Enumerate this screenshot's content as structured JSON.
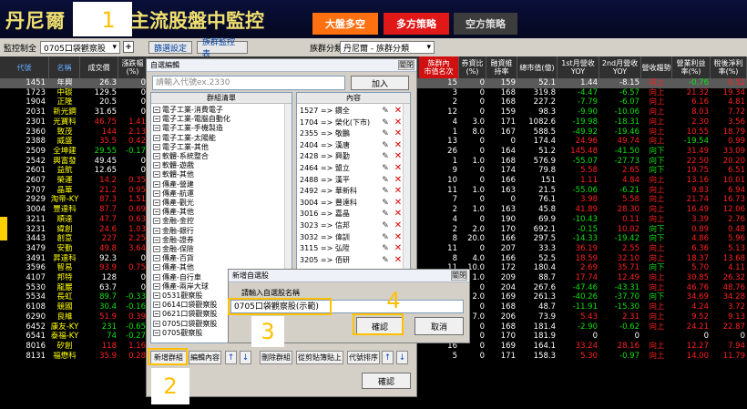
{
  "header": {
    "title_left": "丹尼爾",
    "title_right": "主流股盤中監控",
    "buttons": [
      "大盤多空",
      "多方策略",
      "空方策略"
    ]
  },
  "toolbar": {
    "monitor_label": "監控制全",
    "list_value": "0705口袋觀察股",
    "plus": "+",
    "filter_btn": "篩選設定",
    "group_btn": "族群監控表",
    "sector_label": "族群分類",
    "sector_value": "丹尼爾 - 族群分類"
  },
  "table": {
    "headers": [
      "代號",
      "名稱",
      "成交價",
      "漲跌幅\n(%)",
      "",
      "",
      "",
      "族群內\n市值名次",
      "券資比\n(%)",
      "融資維\n持率",
      "總市值(億)",
      "1st月營收\nYOY",
      "2nd月營收\nYOY",
      "營收趨勢",
      "營業利益\n率(%)",
      "稅後淨利\n率(%)"
    ],
    "rows": [
      {
        "code": "1451",
        "name": "年興",
        "price": "26.3",
        "chg": "0",
        "rank": "15",
        "qz": "0",
        "rz": "159",
        "cap": "52.1",
        "y1": "1.44",
        "y2": "-8.15",
        "tr": "向上",
        "op": "-0.76",
        "np": "0.52",
        "c": [
          "w",
          "w",
          "w",
          "w"
        ],
        "sel": true
      },
      {
        "code": "1723",
        "name": "中碳",
        "price": "129.5",
        "chg": "0",
        "rank": "3",
        "qz": "0",
        "rz": "168",
        "cap": "319.8",
        "y1": "-4.47",
        "y2": "-6.57",
        "tr": "向上",
        "op": "21.32",
        "np": "19.34",
        "c": [
          "w",
          "w",
          "g",
          "g"
        ]
      },
      {
        "code": "1904",
        "name": "正隆",
        "price": "20.5",
        "chg": "0",
        "rank": "2",
        "qz": "0",
        "rz": "168",
        "cap": "227.2",
        "y1": "-7.79",
        "y2": "-6.07",
        "tr": "向上",
        "op": "6.16",
        "np": "4.81",
        "c": [
          "w",
          "w",
          "g",
          "g"
        ]
      },
      {
        "code": "2031",
        "name": "新光鋼",
        "price": "31.65",
        "chg": "0",
        "rank": "12",
        "qz": "0",
        "rz": "159",
        "cap": "98.3",
        "y1": "-9.90",
        "y2": "-10.06",
        "tr": "向上",
        "op": "8.03",
        "np": "7.72",
        "c": [
          "w",
          "w",
          "g",
          "g"
        ]
      },
      {
        "code": "2301",
        "name": "光寶科",
        "price": "46.75",
        "chg": "1.41",
        "rank": "4",
        "qz": "3.0",
        "rz": "171",
        "cap": "1082.6",
        "y1": "-19.98",
        "y2": "-18.31",
        "tr": "向上",
        "op": "2.30",
        "np": "3.56",
        "c": [
          "r",
          "r",
          "g",
          "g"
        ]
      },
      {
        "code": "2360",
        "name": "致茂",
        "price": "144",
        "chg": "2.13",
        "rank": "1",
        "qz": "8.0",
        "rz": "167",
        "cap": "588.5",
        "y1": "-49.92",
        "y2": "-19.46",
        "tr": "向上",
        "op": "10.55",
        "np": "18.79",
        "c": [
          "r",
          "r",
          "g",
          "g"
        ]
      },
      {
        "code": "2388",
        "name": "威盛",
        "price": "35.5",
        "chg": "0.42",
        "rank": "13",
        "qz": "0",
        "rz": "0",
        "cap": "174.4",
        "y1": "24.96",
        "y2": "49.74",
        "tr": "向上",
        "op": "-19.54",
        "np": "0.99",
        "c": [
          "r",
          "r",
          "r",
          "r"
        ]
      },
      {
        "code": "2509",
        "name": "全坤建",
        "price": "29.55",
        "chg": "-0.17",
        "rank": "26",
        "qz": "0",
        "rz": "164",
        "cap": "51.2",
        "y1": "145.48",
        "y2": "-41.50",
        "tr": "向下",
        "op": "31.49",
        "np": "33.09",
        "c": [
          "g",
          "g",
          "r",
          "g"
        ]
      },
      {
        "code": "2542",
        "name": "興富發",
        "price": "49.45",
        "price_c": "w",
        "chg": "0",
        "rank": "1",
        "qz": "1.0",
        "rz": "168",
        "cap": "576.9",
        "y1": "-55.07",
        "y2": "-27.73",
        "tr": "向下",
        "op": "22.50",
        "np": "20.20",
        "c": [
          "w",
          "w",
          "g",
          "g"
        ]
      },
      {
        "code": "2601",
        "name": "益航",
        "price": "12.65",
        "chg": "0",
        "rank": "9",
        "qz": "0",
        "rz": "174",
        "cap": "79.8",
        "y1": "5.58",
        "y2": "2.65",
        "tr": "向下",
        "op": "19.75",
        "np": "6.51",
        "c": [
          "w",
          "w",
          "r",
          "r"
        ]
      },
      {
        "code": "2607",
        "name": "榮運",
        "price": "14.2",
        "chg": "0.35",
        "rank": "10",
        "qz": "0",
        "rz": "166",
        "cap": "151",
        "y1": "1.11",
        "y2": "4.84",
        "tr": "向上",
        "op": "13.16",
        "np": "10.01",
        "c": [
          "r",
          "r",
          "r",
          "r"
        ]
      },
      {
        "code": "2707",
        "name": "晶華",
        "price": "21.2",
        "chg": "0.95",
        "rank": "11",
        "qz": "1.0",
        "rz": "163",
        "cap": "21.5",
        "y1": "-55.06",
        "y2": "-6.21",
        "tr": "向上",
        "op": "9.83",
        "np": "6.94",
        "c": [
          "r",
          "r",
          "g",
          "g"
        ]
      },
      {
        "code": "2929",
        "name": "淘帝-KY",
        "price": "87.3",
        "chg": "1.51",
        "rank": "7",
        "qz": "0",
        "rz": "0",
        "cap": "76.1",
        "y1": "3.98",
        "y2": "5.58",
        "tr": "向上",
        "op": "21.74",
        "np": "16.73",
        "c": [
          "r",
          "r",
          "r",
          "r"
        ]
      },
      {
        "code": "3004",
        "name": "豐達科",
        "price": "87.7",
        "chg": "0.69",
        "rank": "2",
        "qz": "1.0",
        "rz": "163",
        "cap": "45.8",
        "y1": "41.89",
        "y2": "28.30",
        "tr": "向上",
        "op": "16.49",
        "np": "12.06",
        "c": [
          "r",
          "r",
          "r",
          "r"
        ]
      },
      {
        "code": "3211",
        "name": "順達",
        "price": "47.7",
        "chg": "0.63",
        "rank": "4",
        "qz": "0",
        "rz": "190",
        "cap": "69.9",
        "y1": "-10.43",
        "y2": "0.11",
        "tr": "向上",
        "op": "3.39",
        "np": "2.76",
        "c": [
          "r",
          "r",
          "g",
          "r"
        ]
      },
      {
        "code": "3231",
        "name": "緯創",
        "price": "24.6",
        "chg": "1.03",
        "rank": "2",
        "qz": "2.0",
        "rz": "170",
        "cap": "692.1",
        "y1": "-0.15",
        "y2": "10.02",
        "tr": "向下",
        "op": "0.89",
        "np": "0.48",
        "c": [
          "r",
          "r",
          "g",
          "r"
        ]
      },
      {
        "code": "3443",
        "name": "創意",
        "price": "227",
        "chg": "2.25",
        "rank": "8",
        "qz": "20.0",
        "rz": "166",
        "cap": "297.5",
        "y1": "-14.33",
        "y2": "-19.42",
        "tr": "向下",
        "op": "4.86",
        "np": "5.96",
        "c": [
          "r",
          "r",
          "g",
          "g"
        ]
      },
      {
        "code": "3479",
        "name": "安勤",
        "price": "49.8",
        "chg": "3.64",
        "rank": "11",
        "qz": "0",
        "rz": "207",
        "cap": "33.3",
        "y1": "36.19",
        "y2": "2.55",
        "tr": "向上",
        "op": "6.36",
        "np": "5.13",
        "c": [
          "r",
          "r",
          "r",
          "r"
        ]
      },
      {
        "code": "3491",
        "name": "昇達科",
        "price": "92.3",
        "chg": "0",
        "rank": "8",
        "qz": "4.0",
        "rz": "166",
        "cap": "52.5",
        "y1": "18.59",
        "y2": "32.10",
        "tr": "向上",
        "op": "18.37",
        "np": "13.68",
        "c": [
          "w",
          "w",
          "r",
          "r"
        ]
      },
      {
        "code": "3596",
        "name": "智易",
        "price": "93.9",
        "chg": "0.75",
        "rank": "11",
        "qz": "10.0",
        "rz": "172",
        "cap": "180.4",
        "y1": "2.69",
        "y2": "35.71",
        "tr": "向下",
        "op": "5.70",
        "np": "4.11",
        "c": [
          "r",
          "r",
          "r",
          "r"
        ]
      },
      {
        "code": "4107",
        "name": "邦特",
        "price": "128",
        "chg": "0",
        "rank": "1",
        "qz": "1.0",
        "rz": "209",
        "cap": "88.7",
        "y1": "17.74",
        "y2": "12.49",
        "tr": "向上",
        "op": "30.85",
        "np": "26.32",
        "c": [
          "w",
          "w",
          "r",
          "r"
        ]
      },
      {
        "code": "5530",
        "name": "龍巖",
        "price": "63.7",
        "chg": "0",
        "rank": "1",
        "qz": "0",
        "rz": "204",
        "cap": "267.6",
        "y1": "-47.46",
        "y2": "-43.31",
        "tr": "向上",
        "op": "46.76",
        "np": "48.76",
        "c": [
          "w",
          "w",
          "g",
          "g"
        ]
      },
      {
        "code": "5534",
        "name": "長虹",
        "price": "89.7",
        "chg": "-0.33",
        "rank": "3",
        "qz": "2.0",
        "rz": "169",
        "cap": "261.3",
        "y1": "-40.26",
        "y2": "-37.70",
        "tr": "向下",
        "op": "34.69",
        "np": "34.28",
        "c": [
          "g",
          "g",
          "g",
          "g"
        ]
      },
      {
        "code": "6108",
        "name": "競國",
        "price": "30.4",
        "chg": "-0.16",
        "rank": "8",
        "qz": "0",
        "rz": "168",
        "cap": "48.7",
        "y1": "-11.91",
        "y2": "-15.30",
        "tr": "向上",
        "op": "4.24",
        "np": "3.72",
        "c": [
          "g",
          "g",
          "g",
          "g"
        ]
      },
      {
        "code": "6290",
        "name": "良維",
        "price": "51.9",
        "chg": "0.39",
        "rank": "9",
        "qz": "7.0",
        "rz": "206",
        "cap": "73.9",
        "y1": "5.43",
        "y2": "2.31",
        "tr": "向上",
        "op": "9.52",
        "np": "9.13",
        "c": [
          "r",
          "r",
          "r",
          "r"
        ]
      },
      {
        "code": "6452",
        "name": "康友-KY",
        "price": "231",
        "chg": "-0.65",
        "rank": "9",
        "qz": "0",
        "rz": "168",
        "cap": "181.4",
        "y1": "-2.90",
        "y2": "-0.62",
        "tr": "向上",
        "op": "24.21",
        "np": "22.87",
        "c": [
          "g",
          "g",
          "g",
          "g"
        ]
      },
      {
        "code": "6541",
        "name": "泰福-KY",
        "price": "74",
        "chg": "-0.27",
        "rank": "6",
        "qz": "0",
        "rz": "170",
        "cap": "181.9",
        "y1": "0",
        "y2": "0",
        "tr": "",
        "op": "0",
        "np": "0",
        "c": [
          "g",
          "g",
          "w",
          "w"
        ]
      },
      {
        "code": "8016",
        "name": "矽創",
        "price": "118",
        "chg": "1.16",
        "rank": "16",
        "qz": "0",
        "rz": "169",
        "cap": "164.1",
        "y1": "33.24",
        "y2": "28.16",
        "tr": "向上",
        "op": "12.27",
        "np": "7.94",
        "c": [
          "r",
          "r",
          "r",
          "r"
        ]
      },
      {
        "code": "8131",
        "name": "福懋科",
        "price": "35.9",
        "chg": "0.28",
        "rank": "5",
        "qz": "0",
        "rz": "171",
        "cap": "158.3",
        "y1": "5.30",
        "y2": "-0.97",
        "tr": "向上",
        "op": "14.00",
        "np": "11.79",
        "c": [
          "r",
          "r",
          "r",
          "g"
        ]
      }
    ]
  },
  "dialog_watch": {
    "title": "自選編輯",
    "close": "關閉",
    "search_placeholder": "請輸入代號ex.2330",
    "add_btn": "加入",
    "group_header": "群組清單",
    "content_header": "內容",
    "groups": [
      "電子工業-消費電子",
      "電子工業-電腦自動化",
      "電子工業-手機製造",
      "電子工業-太陽能",
      "電子工業-其他",
      "軟體-系統整合",
      "軟體-遊戲",
      "軟體-其他",
      "傳產-營建",
      "傳產-航運",
      "傳產-觀光",
      "傳產-其他",
      "金融-金控",
      "金融-銀行",
      "金融-證券",
      "金融-保險",
      "傳產-百貨",
      "傳產-其他",
      "傳產-自行車",
      "傳產-兩岸大球",
      "0531觀察股",
      "0614口袋觀察股",
      "0621口袋觀察股",
      "0705口袋觀察股",
      "0705觀察股"
    ],
    "contents": [
      "1527 => 鑽全",
      "1704 => 榮化(下市)",
      "2355 => 敬鵬",
      "2404 => 漢唐",
      "2428 => 興勤",
      "2464 => 盟立",
      "2488 => 漢平",
      "2492 => 華新科",
      "3004 => 豐達科",
      "3016 => 嘉晶",
      "3023 => 信邦",
      "3032 => 偉訓",
      "3115 => 弘陞",
      "3205 => 佰研"
    ],
    "buttons": {
      "new_group": "新增群組",
      "edit_content": "編輯內容",
      "delete_group": "刪除群組",
      "paste": "從剪貼簿貼上",
      "sort": "代號排序",
      "ok": "確認"
    },
    "arrows": [
      "↑",
      "↓"
    ]
  },
  "dialog_new": {
    "title": "新增自選股",
    "close": "關閉",
    "prompt": "請輸入自選股名稱",
    "value": "0705口袋觀察股(示範)",
    "ok": "確認",
    "cancel": "取消"
  },
  "annotations": [
    "1",
    "2",
    "3",
    "4"
  ]
}
